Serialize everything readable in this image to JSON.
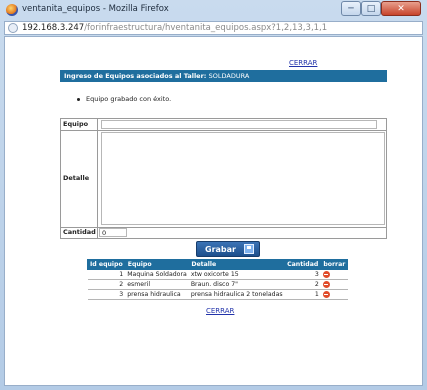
{
  "window": {
    "title": "ventanita_equipos - Mozilla Firefox",
    "controls": {
      "minimize": "─",
      "maximize": "□",
      "close": "✕"
    }
  },
  "address": {
    "host": "192.168.3.247",
    "path": "/forinfraestructura/hventanita_equipos.aspx?1,2,13,3,1,1"
  },
  "page": {
    "cerrar_top": "CERRAR",
    "header_label": "Ingreso de Equipos asociados al Taller:",
    "header_value": "SOLDADURA",
    "message": "Equipo grabado con éxito.",
    "form": {
      "equipo_label": "Equipo",
      "equipo_value": "",
      "detalle_label": "Detalle",
      "detalle_value": "",
      "cantidad_label": "Cantidad",
      "cantidad_value": "0"
    },
    "grabar_label": "Grabar",
    "table": {
      "headers": [
        "Id equipo",
        "Equipo",
        "Detalle",
        "Cantidad",
        "borrar"
      ],
      "rows": [
        {
          "id": "1",
          "equipo": "Maquina Soldadora",
          "detalle": "xtw oxicorte 15",
          "cantidad": "3"
        },
        {
          "id": "2",
          "equipo": "esmeril",
          "detalle": "Braun. disco 7\"",
          "cantidad": "2"
        },
        {
          "id": "3",
          "equipo": "prensa hidraulica",
          "detalle": "prensa hidraulica 2 toneladas",
          "cantidad": "1"
        }
      ]
    },
    "cerrar_bottom": "CERRAR"
  },
  "colors": {
    "header_bg": "#1f6e9e",
    "delete": "#e04b2a",
    "button": "#1d4f8c"
  }
}
